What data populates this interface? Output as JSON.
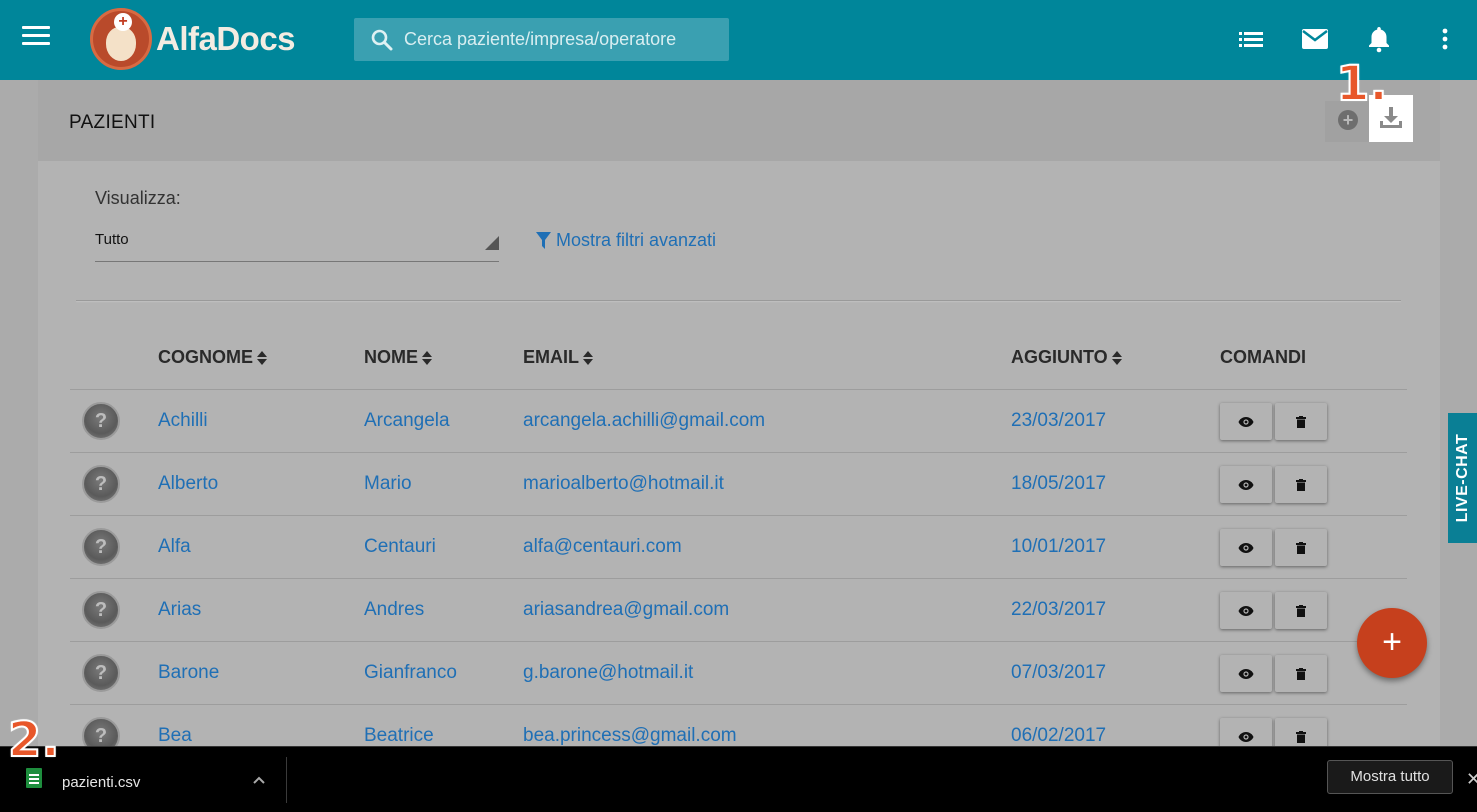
{
  "app": {
    "name": "AlfaDocs"
  },
  "search": {
    "placeholder": "Cerca paziente/impresa/operatore"
  },
  "page": {
    "title": "PAZIENTI"
  },
  "filters": {
    "view_label": "Visualizza:",
    "view_value": "Tutto",
    "advanced_link": "Mostra filtri avanzati"
  },
  "table": {
    "headers": {
      "surname": "COGNOME",
      "name": "NOME",
      "email": "EMAIL",
      "added": "AGGIUNTO",
      "commands": "COMANDI"
    },
    "rows": [
      {
        "surname": "Achilli",
        "name": "Arcangela",
        "email": "arcangela.achilli@gmail.com",
        "added": "23/03/2017"
      },
      {
        "surname": "Alberto",
        "name": "Mario",
        "email": "marioalberto@hotmail.it",
        "added": "18/05/2017"
      },
      {
        "surname": "Alfa",
        "name": "Centauri",
        "email": "alfa@centauri.com",
        "added": "10/01/2017"
      },
      {
        "surname": "Arias",
        "name": "Andres",
        "email": "ariasandrea@gmail.com",
        "added": "22/03/2017"
      },
      {
        "surname": "Barone",
        "name": "Gianfranco",
        "email": "g.barone@hotmail.it",
        "added": "07/03/2017"
      },
      {
        "surname": "Bea",
        "name": "Beatrice",
        "email": "bea.princess@gmail.com",
        "added": "06/02/2017"
      }
    ]
  },
  "livechat": {
    "label": "LIVE-CHAT"
  },
  "steps": {
    "one": "1.",
    "two": "2."
  },
  "download_bar": {
    "file_name": "pazienti.csv",
    "show_all": "Mostra tutto",
    "close": "✕"
  },
  "icons": {
    "menu": "hamburger-icon",
    "search": "search-icon",
    "list": "list-icon",
    "mail": "mail-icon",
    "bell": "bell-icon",
    "more": "more-vert-icon",
    "download": "download-icon",
    "filter": "filter-icon",
    "view": "eye-icon",
    "delete": "trash-icon"
  },
  "colors": {
    "topbar": "#00869a",
    "link": "#1f6fb5",
    "fab": "#c6401d",
    "step_marker": "#e8572a",
    "livechat": "#0a7f95"
  }
}
